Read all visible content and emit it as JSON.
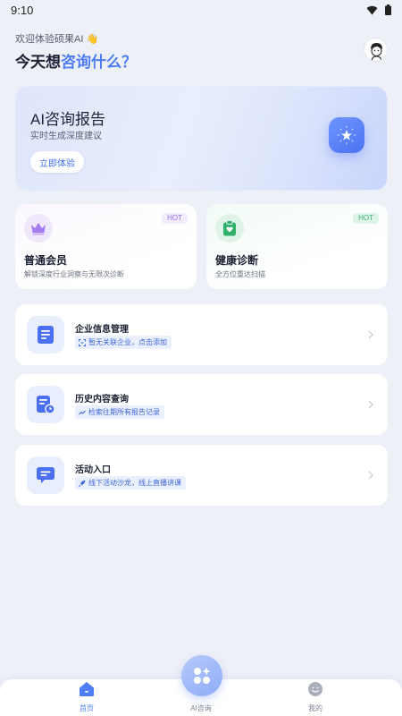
{
  "status_bar": {
    "time": "9:10",
    "wifi_icon": "wifi-icon",
    "battery_icon": "battery-icon"
  },
  "header": {
    "greeting": "欢迎体验硕果AI 👋",
    "headline_prefix": "今天想",
    "headline_accent": "咨询什么？",
    "avatar_icon": "user-avatar"
  },
  "hero": {
    "title": "AI咨询报告",
    "subtitle": "实时生成深度建议",
    "button_label": "立即体验",
    "icon": "sparkle-star-icon"
  },
  "cards": [
    {
      "title": "普通会员",
      "subtitle": "解锁深度行业洞察与无限次诊断",
      "badge": "HOT",
      "icon": "crown-icon",
      "accent": "#9a6ee8"
    },
    {
      "title": "健康诊断",
      "subtitle": "全方位重达扫描",
      "badge": "HOT",
      "icon": "clipboard-heart-icon",
      "accent": "#3fae73"
    }
  ],
  "list": [
    {
      "title": "企业信息管理",
      "tag": "暂无关联企业，点击添加",
      "icon": "document-list-icon",
      "tag_icon": "scan-icon"
    },
    {
      "title": "历史内容查询",
      "tag": "检索往期所有报告记录",
      "icon": "history-doc-icon",
      "tag_icon": "trend-icon"
    },
    {
      "title": "活动入口",
      "tag": "线下活动沙龙，线上直播讲课",
      "icon": "chat-bubble-icon",
      "tag_icon": "rocket-icon"
    }
  ],
  "tabbar": {
    "home_label": "首页",
    "ai_label": "AI咨询",
    "mine_label": "我的"
  },
  "colors": {
    "accent": "#4f7df5",
    "background": "#eef0f8"
  }
}
